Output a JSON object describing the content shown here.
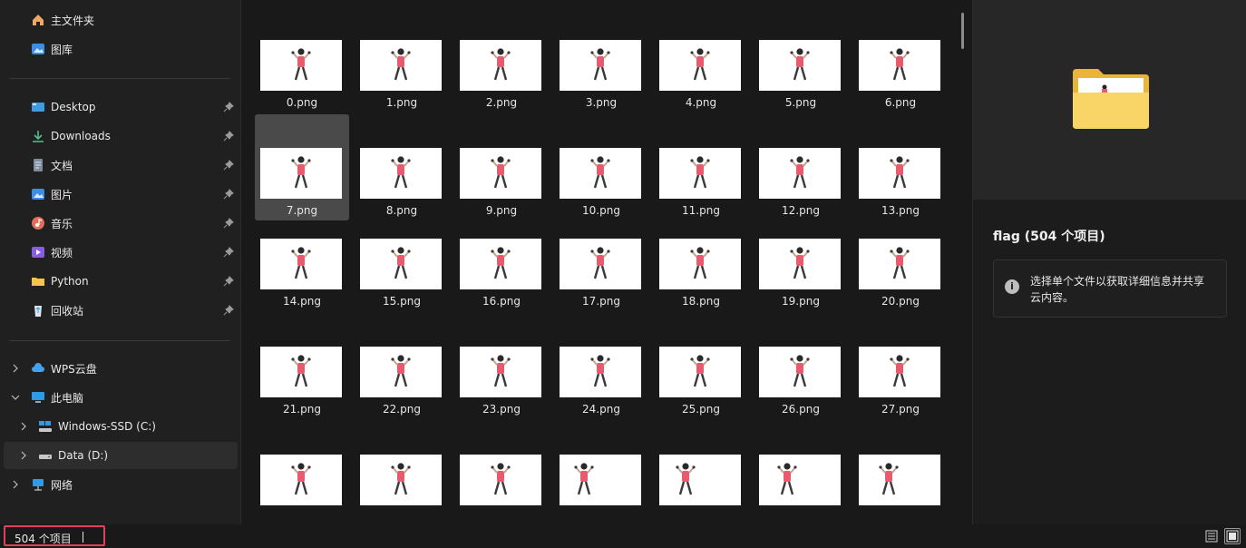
{
  "sidebar": {
    "top_items": [
      {
        "label": "主文件夹",
        "icon": "home-icon"
      },
      {
        "label": "图库",
        "icon": "gallery-icon"
      }
    ],
    "quick_access": [
      {
        "label": "Desktop",
        "icon": "desktop-icon"
      },
      {
        "label": "Downloads",
        "icon": "downloads-icon"
      },
      {
        "label": "文档",
        "icon": "documents-icon"
      },
      {
        "label": "图片",
        "icon": "pictures-icon"
      },
      {
        "label": "音乐",
        "icon": "music-icon"
      },
      {
        "label": "视频",
        "icon": "videos-icon"
      },
      {
        "label": "Python",
        "icon": "folder-icon"
      },
      {
        "label": "回收站",
        "icon": "recycle-bin-icon"
      }
    ],
    "tree": [
      {
        "label": "WPS云盘",
        "icon": "cloud-icon"
      },
      {
        "label": "此电脑",
        "icon": "computer-icon"
      },
      {
        "label": "Windows-SSD (C:)",
        "icon": "drive-icon"
      },
      {
        "label": "Data (D:)",
        "icon": "drive-icon"
      },
      {
        "label": "网络",
        "icon": "network-icon"
      }
    ]
  },
  "files": [
    "0.png",
    "1.png",
    "2.png",
    "3.png",
    "4.png",
    "5.png",
    "6.png",
    "7.png",
    "8.png",
    "9.png",
    "10.png",
    "11.png",
    "12.png",
    "13.png",
    "14.png",
    "15.png",
    "16.png",
    "17.png",
    "18.png",
    "19.png",
    "20.png",
    "21.png",
    "22.png",
    "23.png",
    "24.png",
    "25.png",
    "26.png",
    "27.png",
    "",
    "",
    "",
    "",
    "",
    "",
    ""
  ],
  "selected_file": "7.png",
  "details": {
    "title": "flag (504 个项目)",
    "info": "选择单个文件以获取详细信息并共享云内容。",
    "info_icon": "i"
  },
  "status": {
    "item_count": "504 个项目"
  },
  "colors": {
    "accent_highlight": "#e0405a",
    "figure_shirt": "#e85a6e",
    "folder_yellow": "#f4c542"
  }
}
